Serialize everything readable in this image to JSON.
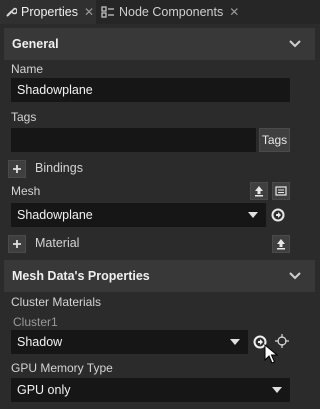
{
  "tabs": [
    {
      "label": "Properties",
      "active": true,
      "icon": "wrench-icon"
    },
    {
      "label": "Node Components",
      "active": false,
      "icon": "components-icon"
    }
  ],
  "sections": {
    "general": {
      "title": "General"
    },
    "mesh_data": {
      "title": "Mesh Data's Properties"
    }
  },
  "general": {
    "name_label": "Name",
    "name_value": "Shadowplane",
    "tags_label": "Tags",
    "tags_value": "",
    "tags_button": "Tags",
    "bindings_label": "Bindings",
    "mesh_label": "Mesh",
    "mesh_value": "Shadowplane",
    "material_label": "Material"
  },
  "mesh_data": {
    "cluster_materials_label": "Cluster Materials",
    "cluster_label": "Cluster1",
    "cluster_value": "Shadow",
    "gpu_memory_label": "GPU Memory Type",
    "gpu_memory_value": "GPU only"
  },
  "colors": {
    "background": "#2b2b2b",
    "section_header": "#383838",
    "field": "#161616",
    "text": "#d8d8d8"
  }
}
